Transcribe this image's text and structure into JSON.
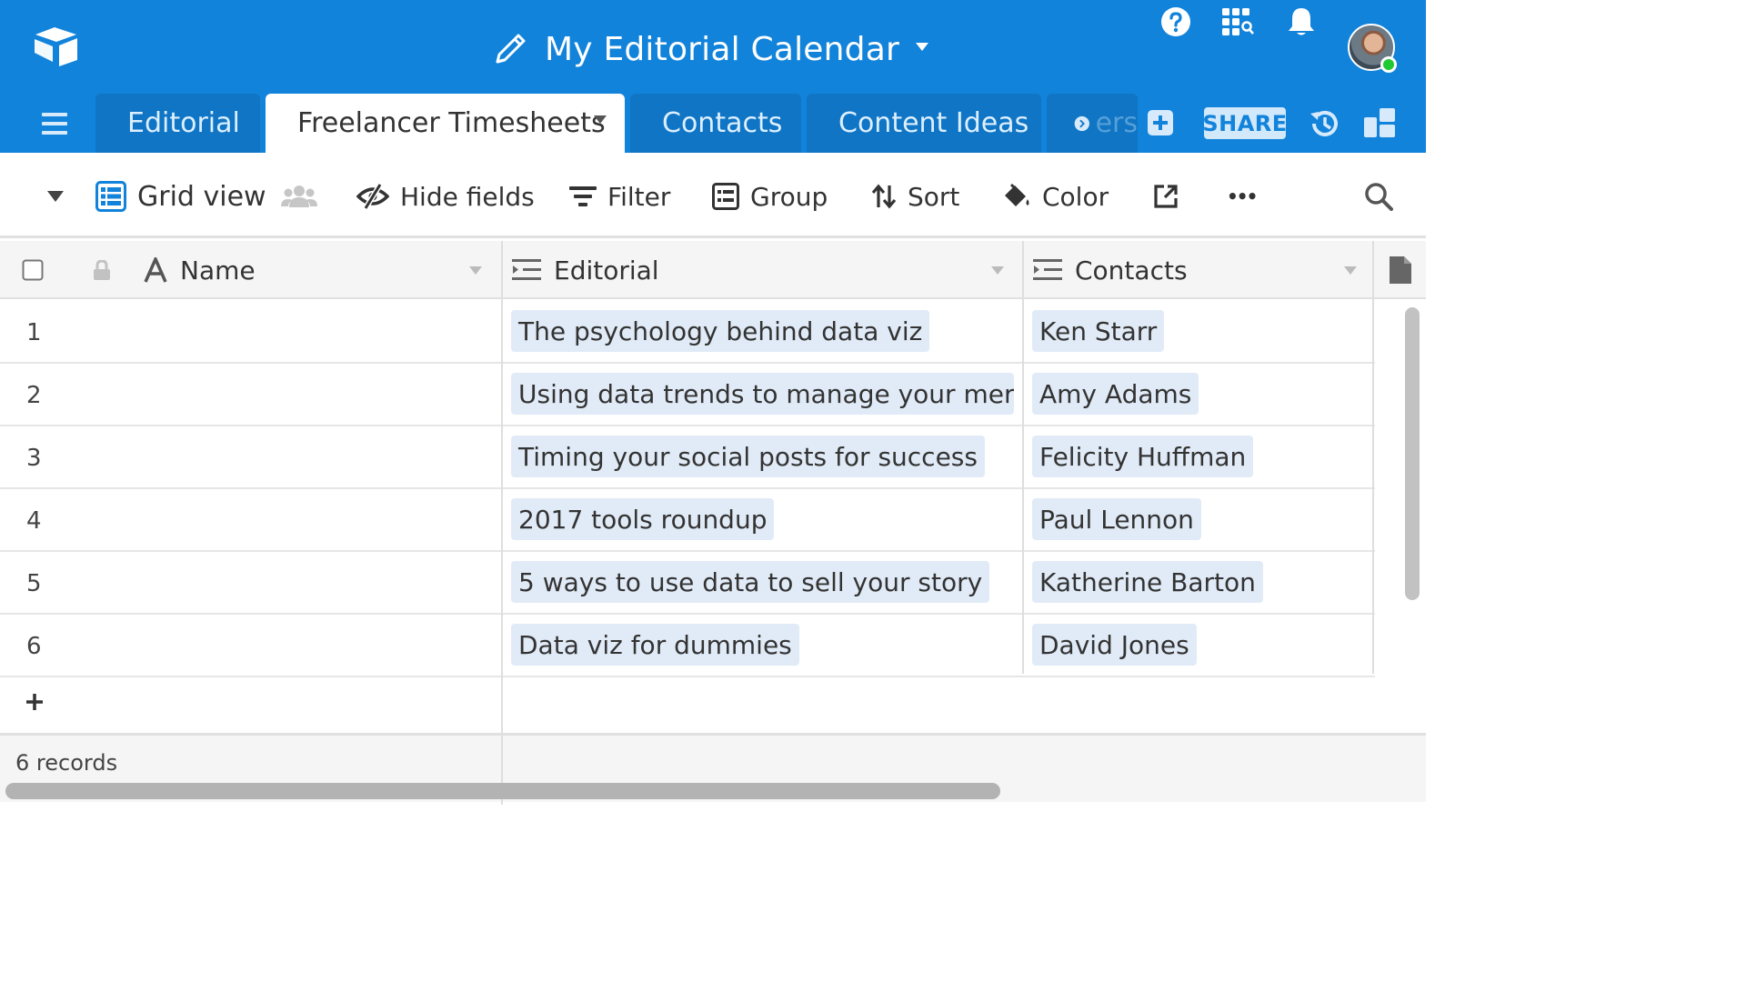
{
  "app": {
    "base_name": "My Editorial Calendar"
  },
  "tables": {
    "tabs": [
      {
        "label": "Editorial",
        "active": false
      },
      {
        "label": "Freelancer Timesheets",
        "active": true
      },
      {
        "label": "Contacts",
        "active": false
      },
      {
        "label": "Content Ideas",
        "active": false
      }
    ],
    "overflow_label": "ers",
    "share_label": "SHARE"
  },
  "toolbar": {
    "view_name": "Grid view",
    "hide_fields": "Hide fields",
    "filter": "Filter",
    "group": "Group",
    "sort": "Sort",
    "color": "Color",
    "more": "•••"
  },
  "grid": {
    "columns": [
      {
        "name": "Name",
        "type": "text"
      },
      {
        "name": "Editorial",
        "type": "link"
      },
      {
        "name": "Contacts",
        "type": "link"
      }
    ],
    "rows": [
      {
        "num": "1",
        "editorial": "The psychology behind data viz",
        "contact": "Ken Starr"
      },
      {
        "num": "2",
        "editorial": "Using data trends to manage your merchanc",
        "contact": "Amy Adams"
      },
      {
        "num": "3",
        "editorial": "Timing your social posts for success",
        "contact": "Felicity Huffman"
      },
      {
        "num": "4",
        "editorial": "2017 tools roundup",
        "contact": "Paul Lennon"
      },
      {
        "num": "5",
        "editorial": "5 ways to use data to sell your story",
        "contact": "Katherine Barton"
      },
      {
        "num": "6",
        "editorial": "Data viz for dummies",
        "contact": "David Jones"
      }
    ],
    "record_count": "6 records"
  },
  "colors": {
    "brand_blue": "#1283da",
    "tab_inactive": "#0f75c4",
    "link_pill": "#e1ebf7",
    "online": "#20c933"
  }
}
